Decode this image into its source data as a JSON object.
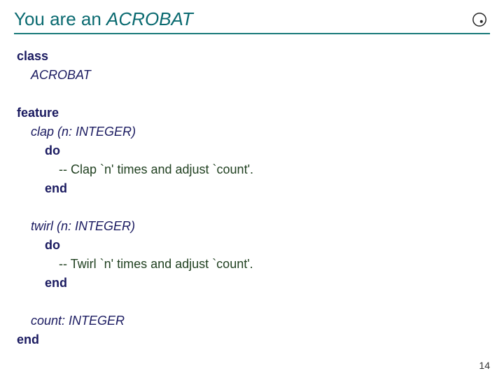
{
  "title": {
    "prefix": "You are an ",
    "emphasis": "ACROBAT"
  },
  "code": {
    "kw_class": "class",
    "class_name": "ACROBAT",
    "kw_feature": "feature",
    "clap_sig": "clap (n: INTEGER)",
    "kw_do1": "do",
    "clap_comment": "-- Clap `n' times and adjust `count'.",
    "kw_end1": "end",
    "twirl_sig": "twirl (n: INTEGER)",
    "kw_do2": "do",
    "twirl_comment": "-- Twirl `n' times and adjust `count'.",
    "kw_end2": "end",
    "count_decl": "count: INTEGER",
    "kw_end_class": "end"
  },
  "page_number": "14"
}
